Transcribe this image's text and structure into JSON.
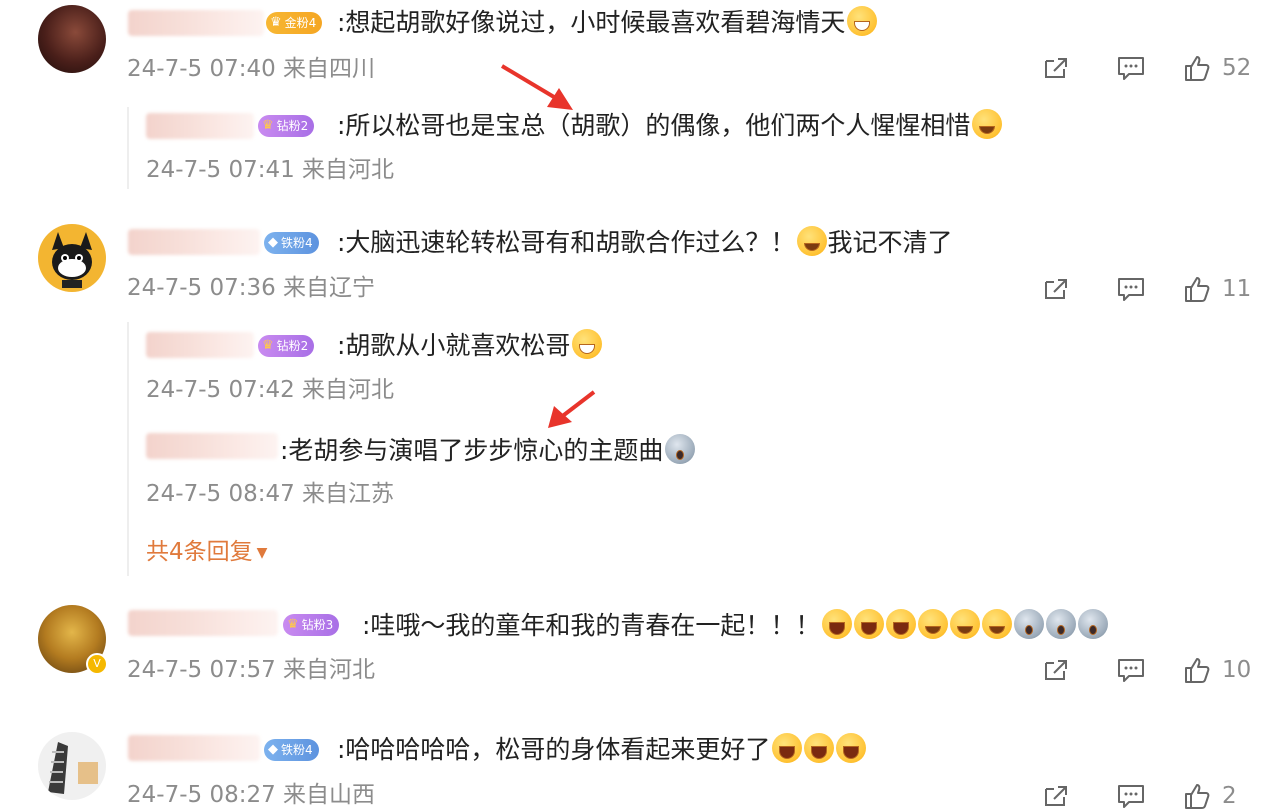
{
  "comments": [
    {
      "badge": "金粉4",
      "text": ":想起胡歌好像说过，小时候最喜欢看碧海情天",
      "meta": "24-7-5 07:40 来自四川",
      "likes": "52",
      "replies": [
        {
          "badge": "钻粉2",
          "text": ":所以松哥也是宝总（胡歌）的偶像，他们两个人惺惺相惜",
          "meta": "24-7-5 07:41 来自河北"
        }
      ]
    },
    {
      "badge": "铁粉4",
      "text": ":大脑迅速轮转松哥有和胡歌合作过么？！",
      "text_after": "我记不清了",
      "meta": "24-7-5 07:36 来自辽宁",
      "likes": "11",
      "replies": [
        {
          "badge": "钻粉2",
          "text": ":胡歌从小就喜欢松哥",
          "meta": "24-7-5 07:42 来自河北"
        },
        {
          "text": ":老胡参与演唱了步步惊心的主题曲",
          "meta": "24-7-5 08:47 来自江苏"
        }
      ],
      "more_replies": "共4条回复"
    },
    {
      "badge": "钻粉3",
      "text": ":哇哦～我的童年和我的青春在一起！！！",
      "meta": "24-7-5 07:57 来自河北",
      "likes": "10"
    },
    {
      "badge": "铁粉4",
      "text": ":哈哈哈哈哈，松哥的身体看起来更好了",
      "meta": "24-7-5 08:27 来自山西",
      "likes": "2"
    }
  ],
  "icons": {
    "share": "share-icon",
    "comment": "comment-icon",
    "like": "like-icon"
  },
  "colors": {
    "meta": "#8c8c8c",
    "more": "#e07a3c",
    "annotation_arrow": "#e8342b"
  }
}
